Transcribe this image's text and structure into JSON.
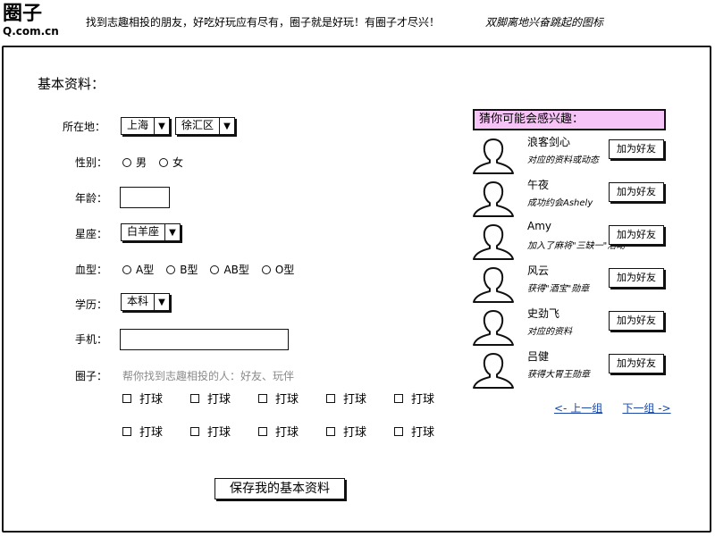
{
  "header": {
    "logo": "圈子",
    "logo_sub": "Q.com.cn",
    "slogan": "找到志趣相投的朋友，好吃好玩应有尽有，圈子就是好玩！有圈子才尽兴！",
    "slogan_note": "双脚离地兴奋跳起的图标"
  },
  "form": {
    "title": "基本资料：",
    "location_label": "所在地：",
    "province": "上海",
    "district": "徐汇区",
    "gender_label": "性别：",
    "gender_options": [
      "男",
      "女"
    ],
    "age_label": "年龄：",
    "age_value": "",
    "sign_label": "星座：",
    "sign_value": "白羊座",
    "blood_label": "血型：",
    "blood_options": [
      "A型",
      "B型",
      "AB型",
      "O型"
    ],
    "education_label": "学历：",
    "education_value": "本科",
    "phone_label": "手机：",
    "phone_value": "",
    "circles_label": "圈子：",
    "circles_hint": "帮你找到志趣相投的人：好友、玩伴",
    "circles_row1": [
      "打球",
      "打球",
      "打球",
      "打球",
      "打球"
    ],
    "circles_row2": [
      "打球",
      "打球",
      "打球",
      "打球",
      "打球"
    ],
    "save_label": "保存我的基本资料"
  },
  "suggestions": {
    "title": "猜你可能会感兴趣：",
    "add_label": "加为好友",
    "friends": [
      {
        "name": "浪客剑心",
        "desc": "对应的资料或动态"
      },
      {
        "name": "午夜",
        "desc": "成功约会Ashely"
      },
      {
        "name": "Amy",
        "desc": "加入了麻将\"三缺一\"活动"
      },
      {
        "name": "风云",
        "desc": "获得\"酒宝\"勋章"
      },
      {
        "name": "史劲飞",
        "desc": "对应的资料"
      },
      {
        "name": "吕健",
        "desc": "获得大胃王勋章"
      }
    ],
    "prev_label": "<- 上一组",
    "next_label": "下一组 ->"
  }
}
